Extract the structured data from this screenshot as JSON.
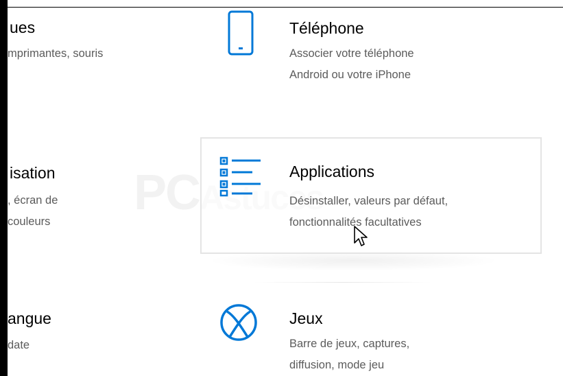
{
  "left_column": {
    "items": [
      {
        "title": "ues",
        "desc_lines": [
          "mprimantes, souris"
        ]
      },
      {
        "title": "isation",
        "desc_lines": [
          ", écran de",
          " couleurs"
        ]
      },
      {
        "title": "angue",
        "desc_lines": [
          " date"
        ]
      }
    ]
  },
  "right_column": {
    "items": [
      {
        "title": "Téléphone",
        "desc_lines": [
          "Associer votre téléphone",
          "Android ou votre iPhone"
        ],
        "icon": "phone-icon"
      },
      {
        "title": "Applications",
        "desc_lines": [
          "Désinstaller, valeurs par défaut,",
          "fonctionnalités facultatives"
        ],
        "icon": "apps-list-icon"
      },
      {
        "title": "Jeux",
        "desc_lines": [
          "Barre de jeux, captures,",
          "diffusion, mode jeu"
        ],
        "icon": "xbox-icon"
      }
    ]
  },
  "watermark": {
    "text": "PCAstuces",
    "icon": "watermark-logo"
  },
  "colors": {
    "accent": "#0078d7",
    "description": "#5b5b5b",
    "hover_border": "#e4e4e4"
  },
  "cursor": {
    "icon": "mouse-pointer-icon"
  }
}
